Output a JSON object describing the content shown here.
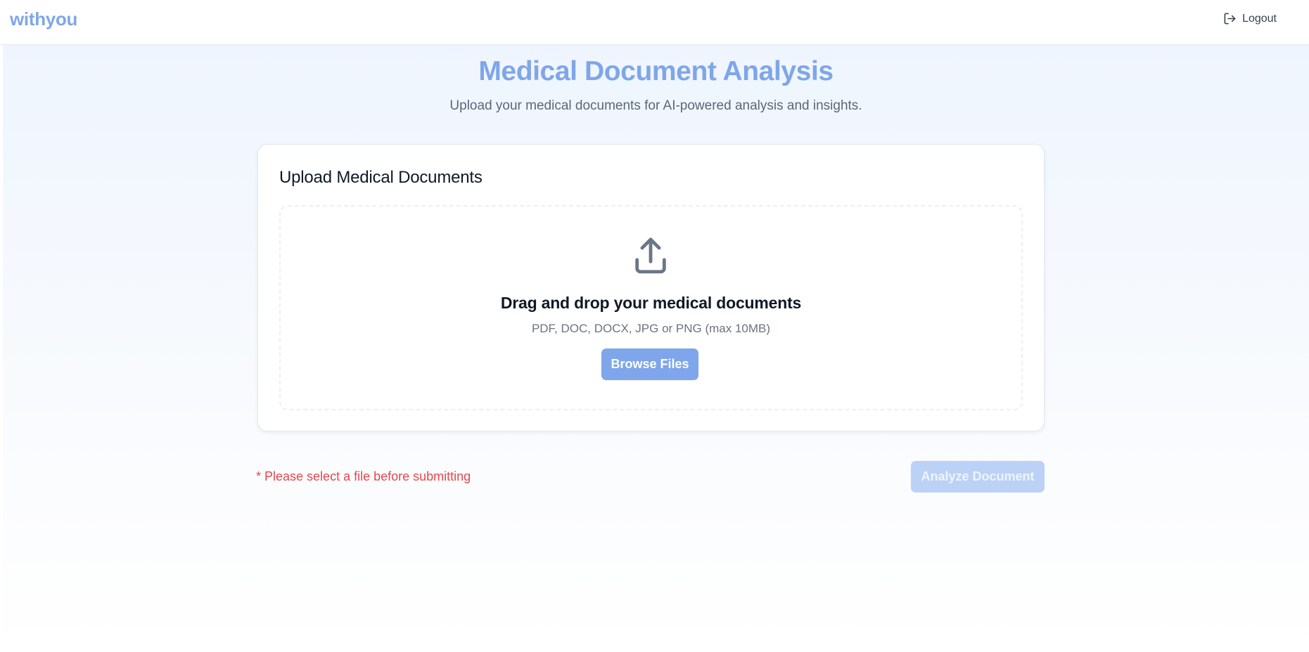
{
  "header": {
    "logo_text": "withyou",
    "logout_label": "Logout",
    "logout_icon": "logout-icon"
  },
  "page": {
    "title": "Medical Document Analysis",
    "subtitle": "Upload your medical documents for AI-powered analysis and insights."
  },
  "upload_card": {
    "title": "Upload Medical Documents",
    "dropzone": {
      "icon": "upload-icon",
      "heading": "Drag and drop your medical documents",
      "hint": "PDF, DOC, DOCX, JPG or PNG (max 10MB)",
      "browse_label": "Browse Files"
    }
  },
  "footer": {
    "error_message": "* Please select a file before submitting",
    "analyze_label": "Analyze Document",
    "analyze_disabled": true
  },
  "colors": {
    "brand": "#7fa6ea",
    "error": "#e5484d",
    "disabled_button": "#bcd1f6"
  }
}
